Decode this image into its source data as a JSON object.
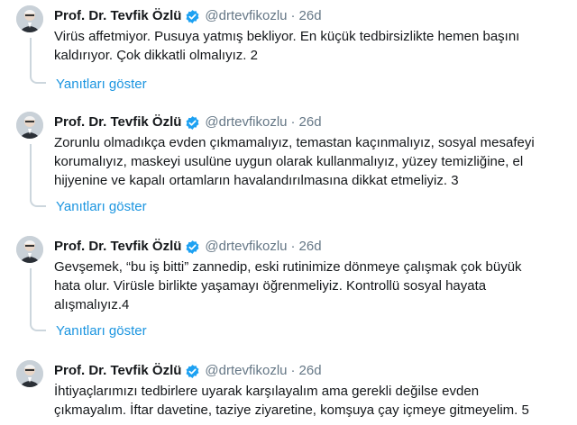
{
  "colors": {
    "link": "#1b95e0",
    "muted": "#657786",
    "text": "#14171a",
    "verified": "#1da1f2",
    "thread": "#ccd6dd"
  },
  "icons": {
    "verified": "verified-badge-icon",
    "avatar": "user-avatar"
  },
  "tweets": [
    {
      "name": "Prof. Dr. Tevfik Özlü",
      "handle": "@drtevfikozlu",
      "separator": "·",
      "time": "26d",
      "lines": [
        "Virüs affetmiyor. Pusuya yatmış bekliyor. En küçük tedbirsizlikte hemen başını",
        "kaldırıyor. Çok dikkatli olmalıyız. 2"
      ],
      "show_replies": "Yanıtları göster"
    },
    {
      "name": "Prof. Dr. Tevfik Özlü",
      "handle": "@drtevfikozlu",
      "separator": "·",
      "time": "26d",
      "lines": [
        "Zorunlu olmadıkça evden çıkmamalıyız, temastan kaçınmalıyız, sosyal mesafeyi",
        "korumalıyız, maskeyi usulüne uygun olarak kullanmalıyız, yüzey temizliğine, el",
        "hijyenine ve kapalı ortamların havalandırılmasına dikkat etmeliyiz. 3"
      ],
      "show_replies": "Yanıtları göster"
    },
    {
      "name": "Prof. Dr. Tevfik Özlü",
      "handle": "@drtevfikozlu",
      "separator": "·",
      "time": "26d",
      "lines": [
        "Gevşemek, “bu iş bitti” zannedip, eski rutinimize dönmeye çalışmak çok büyük",
        "hata olur. Virüsle birlikte yaşamayı öğrenmeliyiz. Kontrollü sosyal hayata",
        "alışmalıyız.4"
      ],
      "show_replies": "Yanıtları göster"
    },
    {
      "name": "Prof. Dr. Tevfik Özlü",
      "handle": "@drtevfikozlu",
      "separator": "·",
      "time": "26d",
      "lines": [
        "İhtiyaçlarımızı tedbirlere uyarak karşılayalım ama gerekli değilse evden",
        "çıkmayalım. İftar davetine, taziye ziyaretine, komşuya çay içmeye gitmeyelim.  5"
      ]
    }
  ]
}
